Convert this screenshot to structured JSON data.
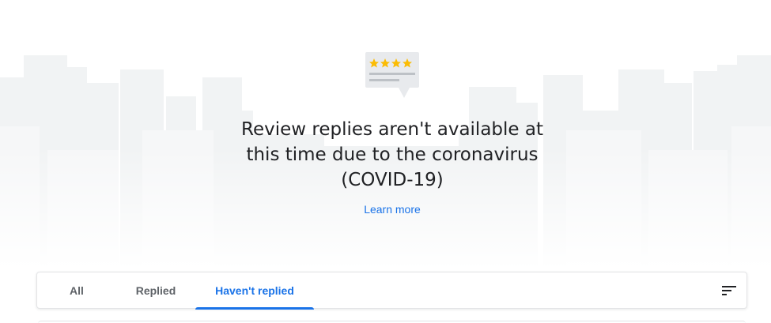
{
  "notice": {
    "message": "Review replies aren't available at this time due to the coronavirus (COVID-19)",
    "learn_more_label": "Learn more",
    "illustration_icon": "review-card-icon",
    "stars_count": 4
  },
  "tabs": [
    {
      "label": "All",
      "active": false
    },
    {
      "label": "Replied",
      "active": false
    },
    {
      "label": "Haven't replied",
      "active": true
    }
  ],
  "sort_icon": "sort-icon",
  "colors": {
    "accent": "#1a73e8",
    "text_primary": "#202124",
    "text_secondary": "#5f6368",
    "star": "#fbbc04",
    "skyline": "#f1f3f4"
  }
}
